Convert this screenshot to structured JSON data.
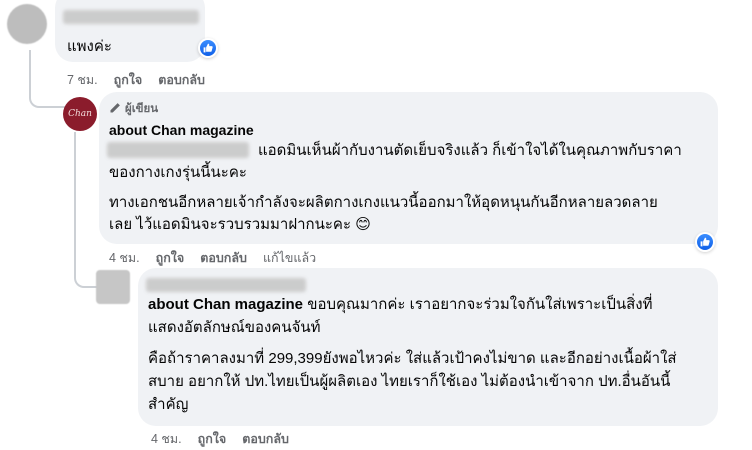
{
  "comment1": {
    "text": "แพงค่ะ",
    "meta": {
      "time": "7 ชม.",
      "like": "ถูกใจ",
      "reply": "ตอบกลับ"
    }
  },
  "reply1": {
    "badge": "ผู้เขียน",
    "avatar_text": "Chan",
    "author": "about Chan magazine",
    "line1": "แอดมินเห็นผ้ากับงานตัดเย็บจริงแล้ว ก็เข้าใจได้ในคุณภาพกับราคา",
    "line2": "ของกางเกงรุ่นนี้นะคะ",
    "para2_line1": "ทางเอกชนอีกหลายเจ้ากำลังจะผลิตกางเกงแนวนี้ออกมาให้อุดหนุนกันอีกหลายลวดลาย",
    "para2_line2": "เลย ไว้แอดมินจะรวบรวมมาฝากนะคะ",
    "emoji": "😊",
    "meta": {
      "time": "4 ชม.",
      "like": "ถูกใจ",
      "reply": "ตอบกลับ",
      "edited": "แก้ไขแล้ว"
    }
  },
  "reply2": {
    "tag": "about Chan magazine",
    "line1": "ขอบคุณมากค่ะ เราอยากจะร่วมใจกันใส่เพราะเป็นสิ่งที่",
    "line2": "แสดงอัตลักษณ์ของคนจันท์",
    "para2_line1": "คือถ้าราคาลงมาที่ 299,399ยังพอไหวค่ะ ใส่แล้วเป้าคงไม่ขาด และอีกอย่างเนื้อผ้าใส่",
    "para2_line2": "สบาย อยากให้ ปท.ไทยเป็นผู้ผลิตเอง ไทยเราก็ใช้เอง ไม่ต้องนำเข้าจาก ปท.อื่นอันนี้",
    "para2_line3": "สำคัญ",
    "meta": {
      "time": "4 ชม.",
      "like": "ถูกใจ",
      "reply": "ตอบกลับ"
    }
  },
  "colors": {
    "bubble": "#f0f2f5",
    "meta": "#65676b",
    "like": "#1877f2",
    "avatar_brand": "#8b1c2c"
  },
  "icons": {
    "like": "thumbs-up-icon",
    "pen": "pen-icon"
  }
}
